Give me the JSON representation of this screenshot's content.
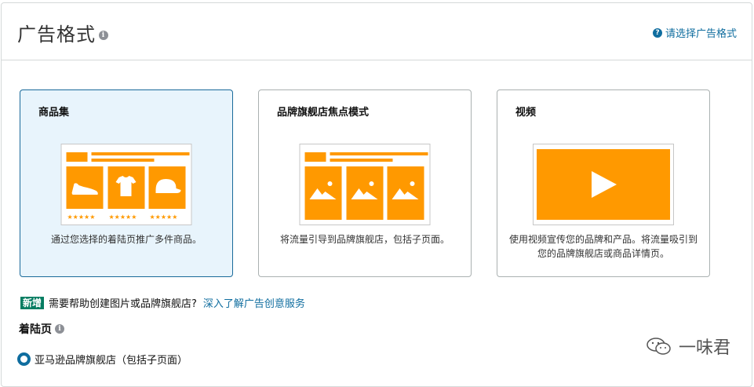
{
  "header": {
    "title": "广告格式",
    "help_link": "请选择广告格式"
  },
  "formats": [
    {
      "title": "商品集",
      "description": "通过您选择的着陆页推广多件商品。",
      "selected": true
    },
    {
      "title": "品牌旗舰店焦点模式",
      "description": "将流量引导到品牌旗舰店，包括子页面。",
      "selected": false
    },
    {
      "title": "视频",
      "description": "使用视频宣传您的品牌和产品。将流量吸引到您的品牌旗舰店或商品详情页。",
      "selected": false
    }
  ],
  "promo": {
    "badge": "新增",
    "text": "需要帮助创建图片或品牌旗舰店?",
    "link": "深入了解广告创意服务"
  },
  "landing_page": {
    "title": "着陆页",
    "option": "亚马逊品牌旗舰店（包括子页面）"
  },
  "watermark": {
    "text": "一味君"
  },
  "colors": {
    "accent_orange": "#ff9900",
    "link_blue": "#0f6d9f",
    "selected_bg": "#e8f4fc",
    "badge_green": "#067d62"
  },
  "icons": [
    "info-icon",
    "help-icon",
    "shoe-icon",
    "tshirt-icon",
    "cap-icon",
    "image-placeholder-icon",
    "play-icon",
    "wechat-icon"
  ]
}
